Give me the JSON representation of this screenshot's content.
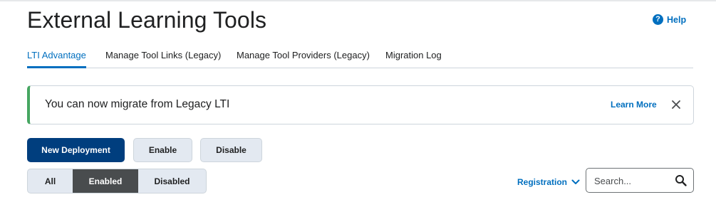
{
  "page": {
    "title": "External Learning Tools",
    "help_label": "Help"
  },
  "icons": {
    "help": "help-circle-icon",
    "close": "close-icon",
    "chevron": "chevron-down-icon",
    "search": "search-icon"
  },
  "colors": {
    "link": "#006fbf",
    "primary_button": "#003e7e",
    "success_accent": "#46a661",
    "selected_filter": "#494c4e"
  },
  "tabs": [
    {
      "label": "LTI Advantage",
      "active": true
    },
    {
      "label": "Manage Tool Links (Legacy)",
      "active": false
    },
    {
      "label": "Manage Tool Providers (Legacy)",
      "active": false
    },
    {
      "label": "Migration Log",
      "active": false
    }
  ],
  "alert": {
    "message": "You can now migrate from Legacy LTI",
    "link_label": "Learn More"
  },
  "actions": {
    "new_label": "New Deployment",
    "enable_label": "Enable",
    "disable_label": "Disable"
  },
  "filter": {
    "options": [
      "All",
      "Enabled",
      "Disabled"
    ],
    "selected": "Enabled"
  },
  "registration": {
    "label": "Registration"
  },
  "search": {
    "placeholder": "Search...",
    "value": ""
  }
}
